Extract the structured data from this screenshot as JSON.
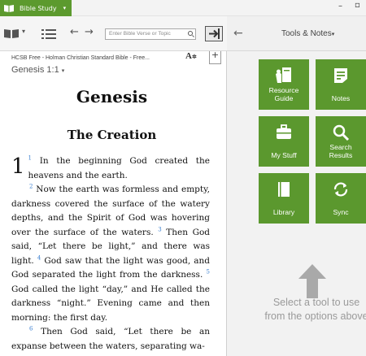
{
  "app": {
    "tab_label": "Bible Study"
  },
  "toolbar": {
    "search_placeholder": "Enter Bible Verse or Topic"
  },
  "text_panel": {
    "bible_name": "HCSB Free - Holman Christian Standard Bible - Free...",
    "reference": "Genesis 1:1",
    "book_title": "Genesis",
    "section_title": "The Creation",
    "chapter_number": "1",
    "verses": [
      {
        "num": "1",
        "text": "In the beginning God created the heavens and the earth."
      },
      {
        "num": "2",
        "text": "Now the earth was formless and empty, darkness covered the surface of the watery depths, and the Spirit of God was hovering over the surface of the waters."
      },
      {
        "num": "3",
        "text": "Then God said, “Let there be light,” and there was light."
      },
      {
        "num": "4",
        "text": "God saw that the light was good, and God separated the light from the darkness."
      },
      {
        "num": "5",
        "text": "God called the light “day,” and He called the darkness “night.” Evening came and then morning: the first day."
      },
      {
        "num": "6",
        "text": "Then God said, “Let there be an expanse between the waters, separating wa-"
      }
    ]
  },
  "tools_panel": {
    "title": "Tools & Notes",
    "tiles": [
      {
        "label_line1": "Resource",
        "label_line2": "Guide",
        "icon": "resource-guide-icon"
      },
      {
        "label_line1": "Notes",
        "label_line2": "",
        "icon": "notes-icon"
      },
      {
        "label_line1": "My Stuff",
        "label_line2": "",
        "icon": "my-stuff-icon"
      },
      {
        "label_line1": "Search",
        "label_line2": "Results",
        "icon": "search-results-icon"
      },
      {
        "label_line1": "Library",
        "label_line2": "",
        "icon": "library-icon"
      },
      {
        "label_line1": "Sync",
        "label_line2": "",
        "icon": "sync-icon"
      }
    ],
    "hint_line1": "Select a tool to use",
    "hint_line2": "from the options above"
  },
  "colors": {
    "accent": "#5b982e",
    "verse_number": "#3a7fd0"
  }
}
